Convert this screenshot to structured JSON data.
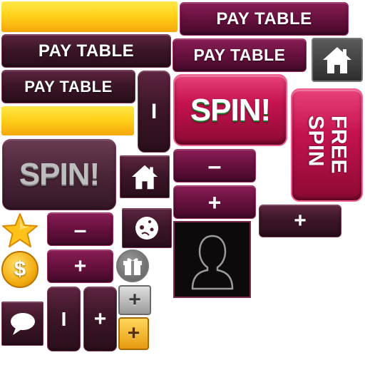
{
  "sprites": {
    "pay_table_label": "PAY TABLE",
    "spin_label": "SPIN!",
    "free_spin_line1": "FREE",
    "free_spin_line2": "SPIN",
    "minus_symbol": "–",
    "plus_symbol": "+",
    "bar_symbol": "I",
    "coin_symbol": "$"
  },
  "colors": {
    "dark_button": "#3c1628",
    "magenta_button": "#6a1140",
    "spin_red": "#c4134f",
    "gold_bar": "#ffd21a",
    "home_grey": "#4a4a4a",
    "star_yellow": "#ffc21a",
    "coin_gold": "#f2a90c"
  },
  "icons": [
    "home-icon",
    "user-avatar-icon",
    "star-icon",
    "coin-icon",
    "gift-icon",
    "chat-icon",
    "settings-face-icon",
    "plus-icon",
    "minus-icon"
  ]
}
